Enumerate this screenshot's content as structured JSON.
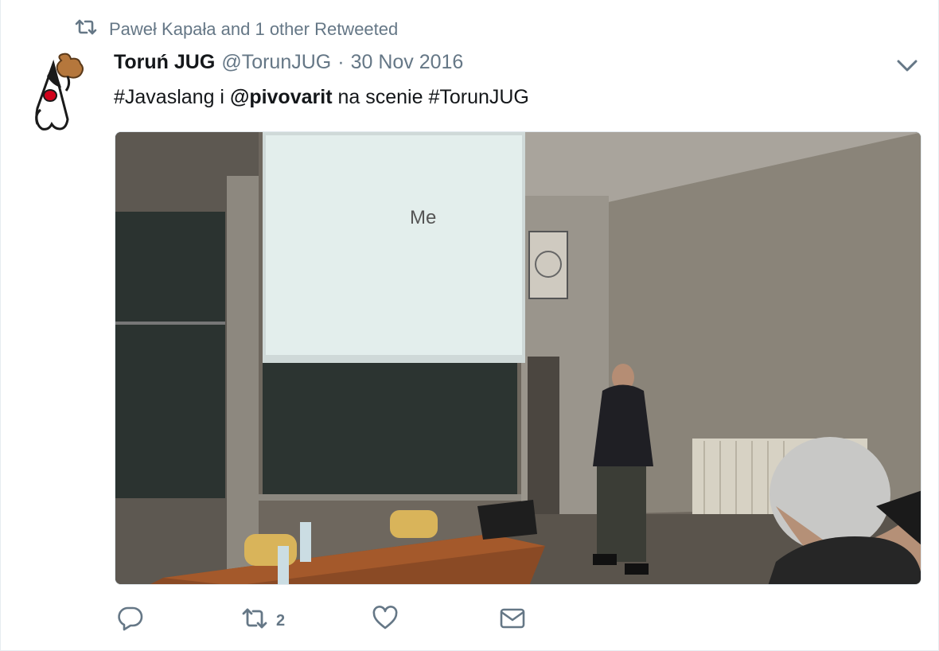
{
  "context": {
    "text": "Paweł Kapała and 1 other Retweeted",
    "icon": "retweet-icon"
  },
  "tweet": {
    "name": "Toruń JUG",
    "handle": "@TorunJUG",
    "separator": "·",
    "date": "30 Nov 2016",
    "text_parts": {
      "hashtag1": "#Javaslang",
      "connector": " i ",
      "mention": "@pivovarit",
      "rest": " na scenie ",
      "hashtag2": "#TorunJUG"
    },
    "media": {
      "slide_text": "Me"
    }
  },
  "actions": {
    "reply": {
      "icon": "reply-icon",
      "count": ""
    },
    "retweet": {
      "icon": "retweet-icon",
      "count": "2"
    },
    "like": {
      "icon": "heart-icon",
      "count": ""
    },
    "message": {
      "icon": "envelope-icon",
      "count": ""
    }
  },
  "colors": {
    "secondary": "#657786",
    "primary": "#14171a",
    "border": "#e6ecf0"
  }
}
